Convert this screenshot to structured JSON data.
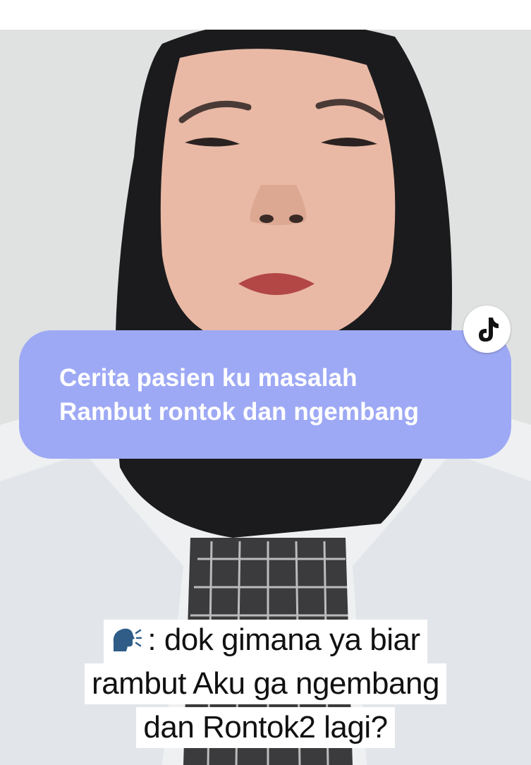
{
  "overlay": {
    "caption_line_1": "Cerita pasien ku masalah",
    "caption_line_2": "Rambut rontok dan ngembang",
    "caption_color": "#9ea9f5"
  },
  "subtitle": {
    "icon": "speaking-head-icon",
    "line_1": ": dok gimana ya biar",
    "line_2": "rambut Aku ga ngembang",
    "line_3": "dan Rontok2 lagi?"
  },
  "logo": {
    "icon": "tiktok-logo-icon"
  }
}
